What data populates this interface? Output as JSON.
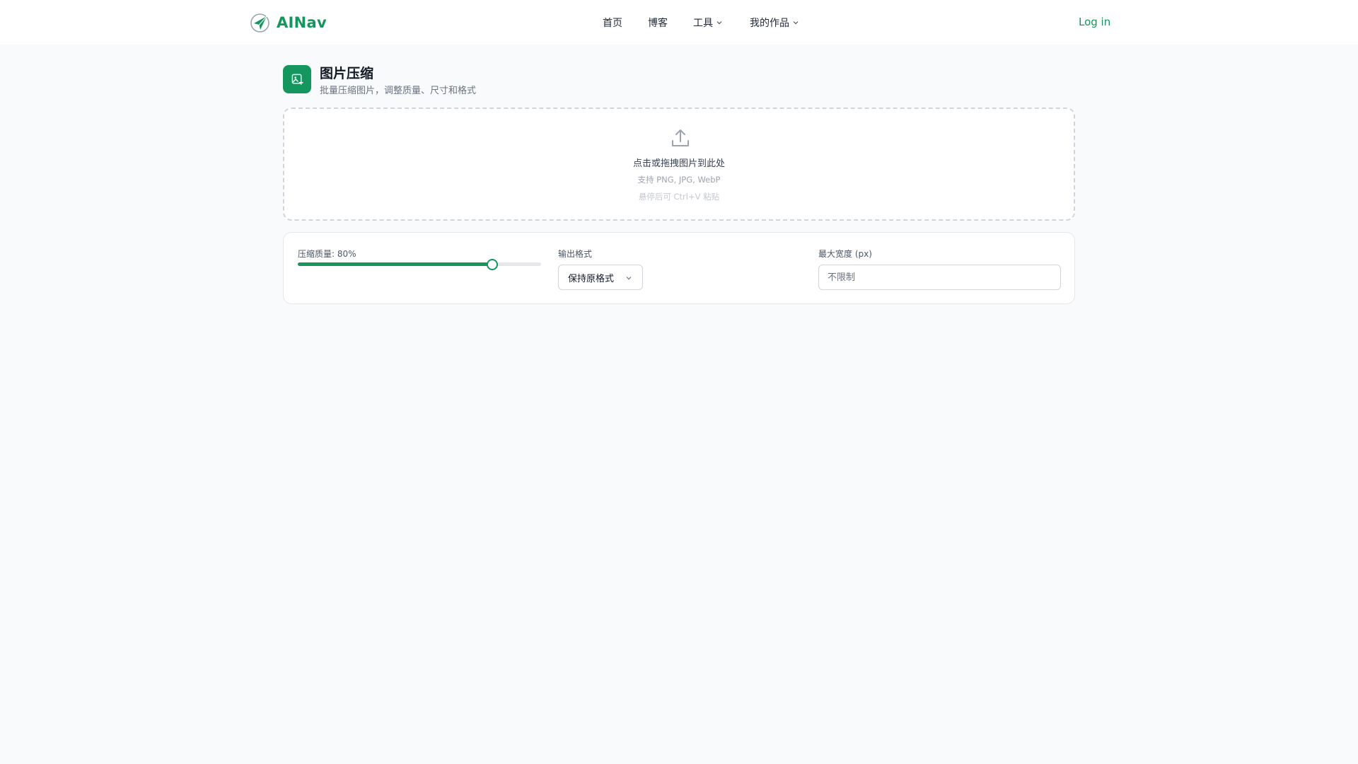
{
  "brand": {
    "name": "AINav",
    "accent": "#14965f"
  },
  "nav": {
    "home": "首页",
    "blog": "博客",
    "tools": "工具",
    "works": "我的作品",
    "login": "Log in"
  },
  "page": {
    "title": "图片压缩",
    "subtitle": "批量压缩图片，调整质量、尺寸和格式",
    "icon": "image-plus-icon"
  },
  "upload": {
    "icon": "upload-icon",
    "main_text": "点击或拖拽图片到此处",
    "formats_text": "支持 PNG, JPG, WebP",
    "paste_text": "悬停后可 Ctrl+V 粘贴"
  },
  "settings": {
    "quality_label": "压缩质量: 80%",
    "quality_value": 0.8,
    "format_label": "输出格式",
    "format_selected": "保持原格式",
    "max_width_label": "最大宽度 (px)",
    "max_width_placeholder": "不限制",
    "max_width_value": ""
  }
}
